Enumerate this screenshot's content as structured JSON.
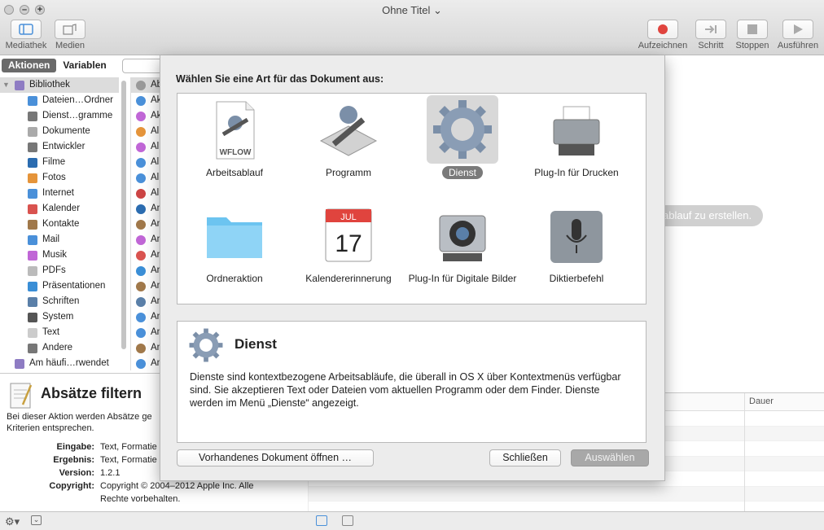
{
  "window": {
    "title": "Ohne Titel",
    "title_chevron": "⌄"
  },
  "toolbar": {
    "left": [
      {
        "label": "Mediathek"
      },
      {
        "label": "Medien"
      }
    ],
    "right": [
      {
        "label": "Aufzeichnen"
      },
      {
        "label": "Schritt"
      },
      {
        "label": "Stoppen"
      },
      {
        "label": "Ausführen"
      }
    ]
  },
  "left": {
    "tabs": [
      "Aktionen",
      "Variablen"
    ],
    "library": [
      {
        "label": "Bibliothek",
        "icon": "library-icon",
        "color": "#8e7cc3"
      },
      {
        "label": "Dateien…Ordner",
        "icon": "finder-icon",
        "color": "#4a90d9"
      },
      {
        "label": "Dienst…gramme",
        "icon": "tools-icon",
        "color": "#777777"
      },
      {
        "label": "Dokumente",
        "icon": "document-icon",
        "color": "#aaaaaa"
      },
      {
        "label": "Entwickler",
        "icon": "tools-icon",
        "color": "#777777"
      },
      {
        "label": "Filme",
        "icon": "film-icon",
        "color": "#2b6cb0"
      },
      {
        "label": "Fotos",
        "icon": "photos-icon",
        "color": "#e5943a"
      },
      {
        "label": "Internet",
        "icon": "globe-icon",
        "color": "#4a90d9"
      },
      {
        "label": "Kalender",
        "icon": "calendar-icon",
        "color": "#d9534f"
      },
      {
        "label": "Kontakte",
        "icon": "contacts-icon",
        "color": "#a0784a"
      },
      {
        "label": "Mail",
        "icon": "mail-icon",
        "color": "#4a90d9"
      },
      {
        "label": "Musik",
        "icon": "music-icon",
        "color": "#c066d6"
      },
      {
        "label": "PDFs",
        "icon": "pdf-icon",
        "color": "#bbbbbb"
      },
      {
        "label": "Präsentationen",
        "icon": "presentation-icon",
        "color": "#3a8ed6"
      },
      {
        "label": "Schriften",
        "icon": "font-icon",
        "color": "#5a7fa8"
      },
      {
        "label": "System",
        "icon": "system-icon",
        "color": "#555555"
      },
      {
        "label": "Text",
        "icon": "text-icon",
        "color": "#cccccc"
      },
      {
        "label": "Andere",
        "icon": "tools-icon",
        "color": "#777777"
      },
      {
        "label": "Am häufi…rwendet",
        "icon": "folder-icon",
        "color": "#8e7cc3"
      }
    ],
    "actions": [
      "Ab",
      "Ak",
      "Ak",
      "Al",
      "Al",
      "Al",
      "Al",
      "Al",
      "An",
      "An",
      "An",
      "An",
      "An",
      "An",
      "An",
      "An",
      "An",
      "An",
      "An"
    ],
    "info": {
      "title": "Absätze filtern",
      "desc": "Bei dieser Aktion werden Absätze ge Kriterien entsprechen.",
      "fields": [
        {
          "k": "Eingabe:",
          "v": "Text, Formatie"
        },
        {
          "k": "Ergebnis:",
          "v": "Text, Formatie"
        },
        {
          "k": "Version:",
          "v": "1.2.1"
        },
        {
          "k": "Copyright:",
          "v": "Copyright © 2004–2012 Apple Inc. Alle Rechte vorbehalten."
        }
      ]
    }
  },
  "right": {
    "hint": "ablauf zu erstellen.",
    "log_header": "Dauer"
  },
  "sheet": {
    "prompt": "Wählen Sie eine Art für das Dokument aus:",
    "types": [
      {
        "label": "Arbeitsablauf",
        "badge": "WFLOW"
      },
      {
        "label": "Programm"
      },
      {
        "label": "Dienst",
        "selected": true
      },
      {
        "label": "Plug-In für Drucken"
      },
      {
        "label": "Ordneraktion"
      },
      {
        "label": "Kalendererinnerung",
        "month": "JUL",
        "day": "17"
      },
      {
        "label": "Plug-In für Digitale Bilder"
      },
      {
        "label": "Diktierbefehl"
      }
    ],
    "detail": {
      "title": "Dienst",
      "text": "Dienste sind kontextbezogene Arbeitsabläufe, die überall in OS X über Kontextmenüs verfügbar sind. Sie akzeptieren Text oder Dateien vom aktuellen Programm oder dem Finder. Dienste werden im Menü „Dienste“ angezeigt."
    },
    "buttons": {
      "open": "Vorhandenes Dokument öffnen …",
      "close": "Schließen",
      "choose": "Auswählen"
    }
  },
  "colors": {
    "record": "#e0443e",
    "accent_selected": "#7a7a7a"
  }
}
